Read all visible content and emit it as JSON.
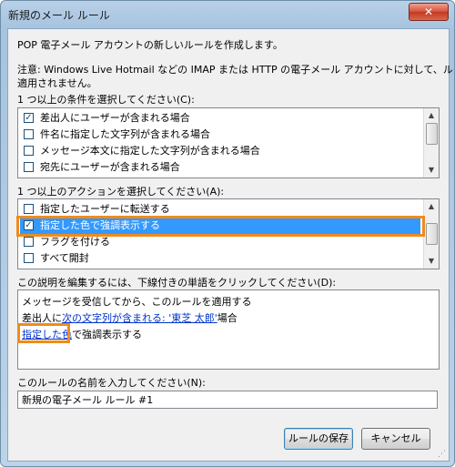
{
  "window": {
    "title": "新規のメール ルール",
    "close_label": "✕"
  },
  "intro": "POP 電子メール アカウントの新しいルールを作成します。",
  "note": {
    "line1": "注意: Windows Live Hotmail などの IMAP または HTTP の電子メール アカウントに対して、ルールは",
    "line2": "適用されません。"
  },
  "conditions": {
    "label": "1 つ以上の条件を選択してください(C):",
    "items": [
      {
        "label": "差出人にユーザーが含まれる場合",
        "checked": true
      },
      {
        "label": "件名に指定した文字列が含まれる場合",
        "checked": false
      },
      {
        "label": "メッセージ本文に指定した文字列が含まれる場合",
        "checked": false
      },
      {
        "label": "宛先にユーザーが含まれる場合",
        "checked": false
      }
    ]
  },
  "actions": {
    "label": "1 つ以上のアクションを選択してください(A):",
    "items": [
      {
        "label": "指定したユーザーに転送する",
        "checked": false
      },
      {
        "label": "指定した色で強調表示する",
        "checked": true
      },
      {
        "label": "フラグを付ける",
        "checked": false
      },
      {
        "label": "すべて開封",
        "checked": false
      }
    ]
  },
  "description": {
    "label": "この説明を編集するには、下線付きの単語をクリックしてください(D):",
    "line1": "メッセージを受信してから、このルールを適用する",
    "line2_prefix": "差出人に",
    "line2_link": "次の文字列が含まれる: '東芝 太郎'",
    "line2_suffix": "場合",
    "line3_link": "指定した色",
    "line3_suffix": "で強調表示する"
  },
  "rule_name": {
    "label": "このルールの名前を入力してください(N):",
    "value": "新規の電子メール ルール #1"
  },
  "buttons": {
    "save": "ルールの保存",
    "cancel": "キャンセル"
  },
  "colors": {
    "selection": "#3399ff",
    "callout": "#f08b1c",
    "link": "#0033cc"
  }
}
